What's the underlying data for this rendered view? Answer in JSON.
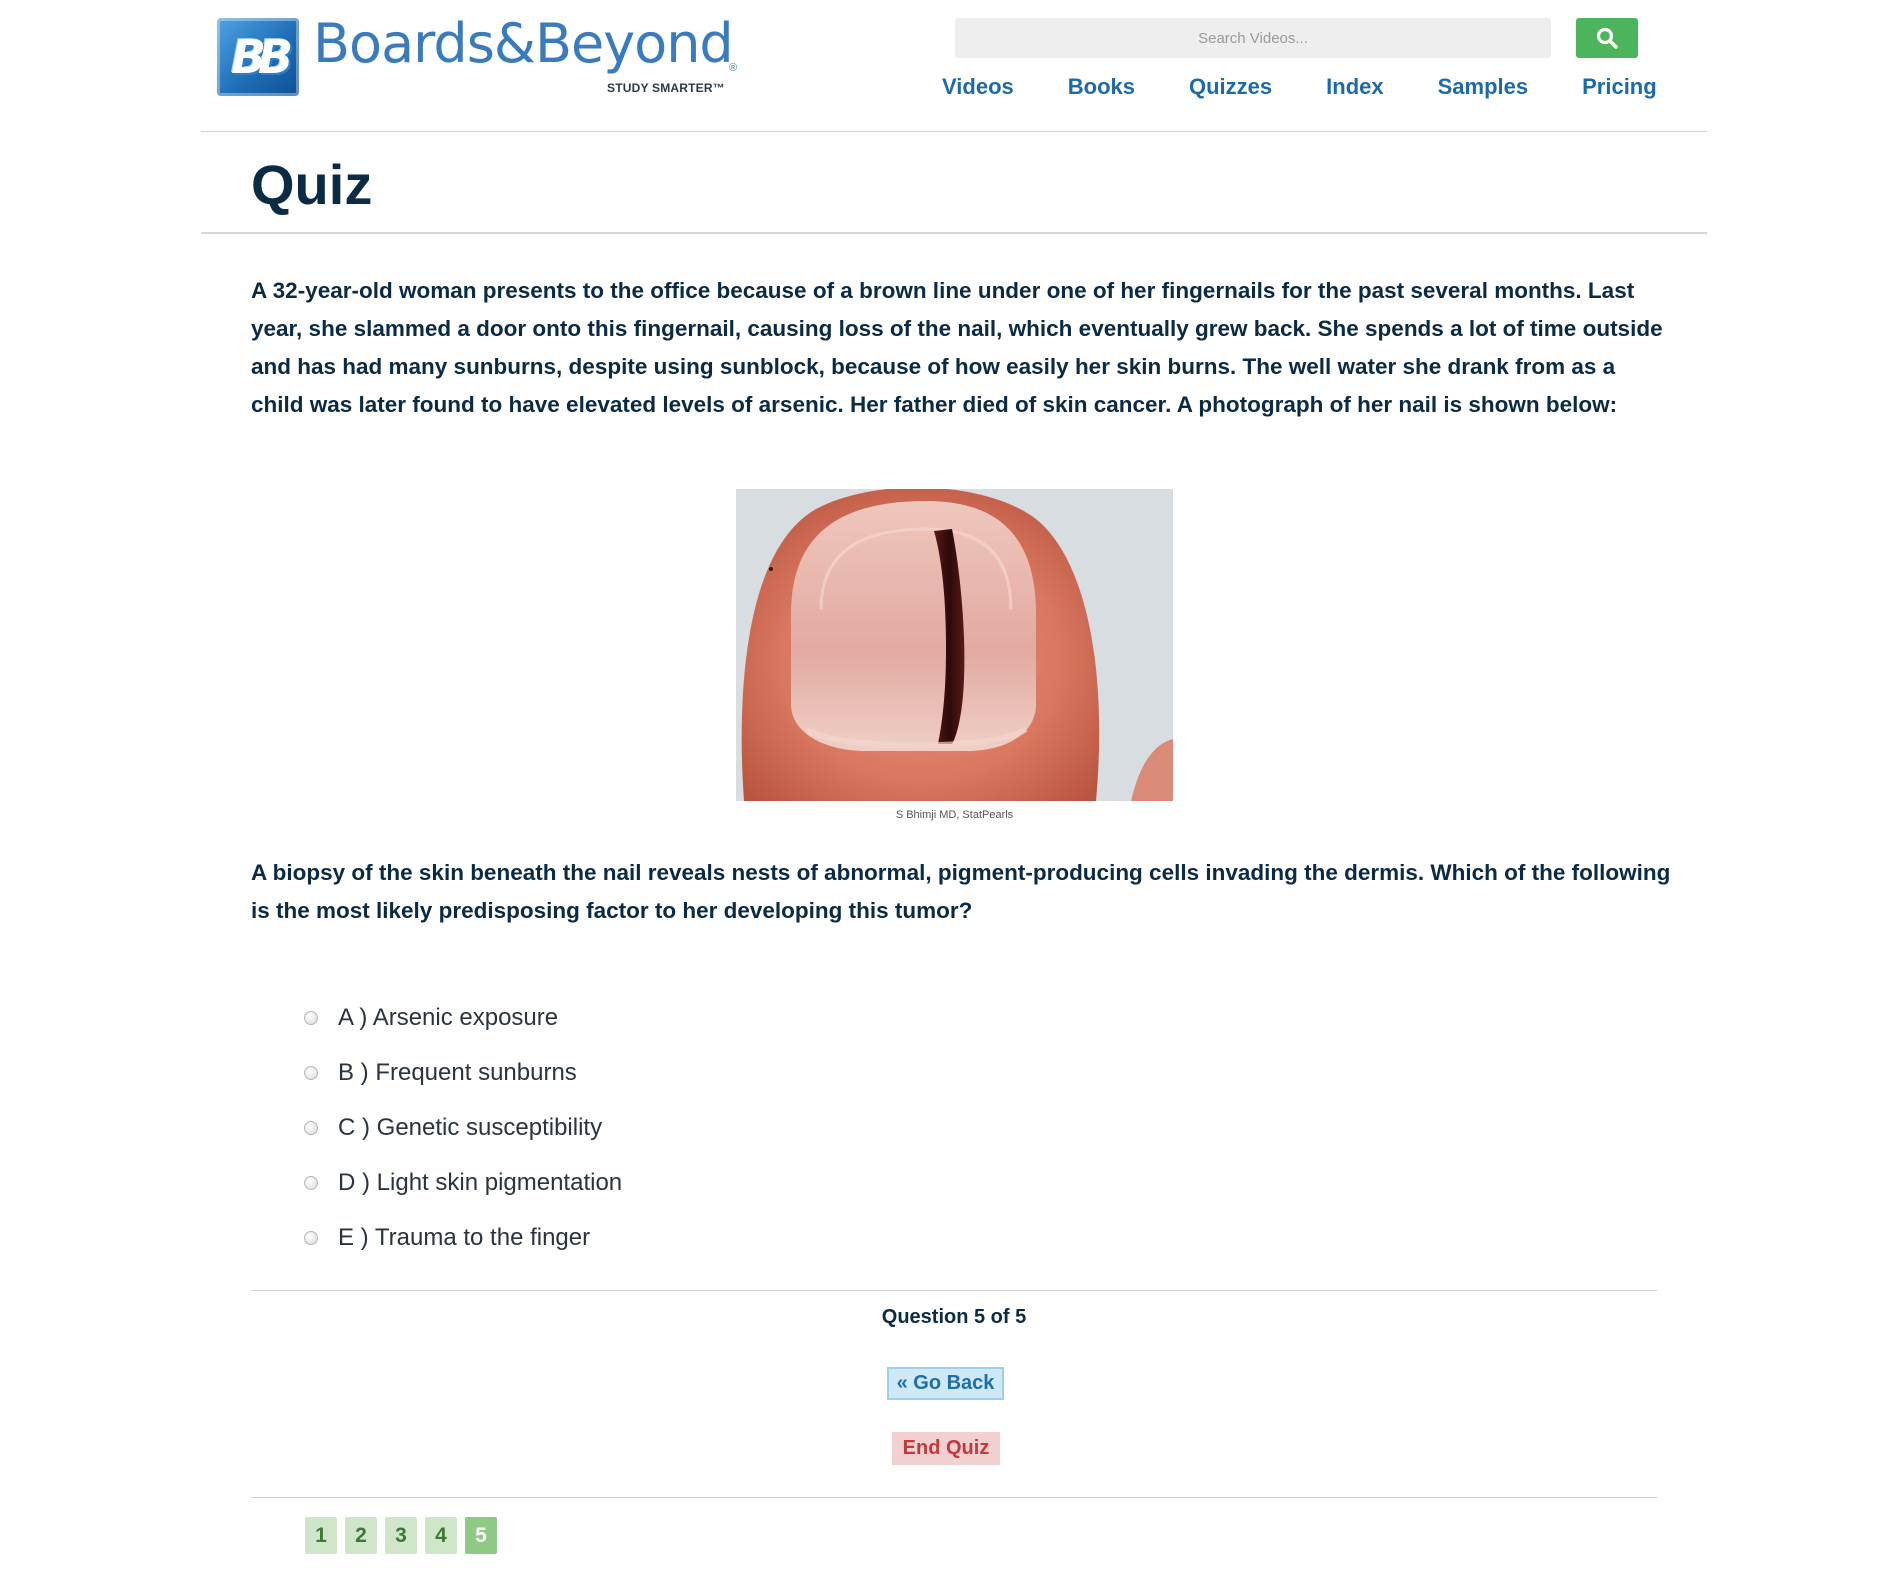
{
  "brand": {
    "badge": "BB",
    "name": "Boards&Beyond",
    "registered": "®",
    "tagline": "STUDY SMARTER™"
  },
  "search": {
    "placeholder": "Search Videos...",
    "button_icon": "search-icon",
    "button_color": "#4cb45c"
  },
  "nav": {
    "items": [
      {
        "label": "Videos"
      },
      {
        "label": "Books"
      },
      {
        "label": "Quizzes"
      },
      {
        "label": "Index"
      },
      {
        "label": "Samples"
      },
      {
        "label": "Pricing"
      }
    ]
  },
  "page": {
    "title": "Quiz"
  },
  "quiz": {
    "stem": "A 32-year-old woman presents to the office because of a brown line under one of her fingernails for the past several months. Last year, she slammed a door onto this fingernail, causing loss of the nail, which eventually grew back. She spends a lot of time outside and has had many sunburns, despite using sunblock, because of how easily her skin burns. The well water she drank from as a child was later found to have elevated levels of arsenic. Her father died of skin cancer. A photograph of her nail is shown below:",
    "image_credit": "S Bhimji MD, StatPearls",
    "question": "A biopsy of the skin beneath the nail reveals nests of abnormal, pigment-producing cells invading the dermis. Which of the following is the most likely predisposing factor to her developing this tumor?",
    "options": [
      {
        "label": "A ) Arsenic exposure"
      },
      {
        "label": "B ) Frequent sunburns"
      },
      {
        "label": "C ) Genetic susceptibility"
      },
      {
        "label": "D ) Light skin pigmentation"
      },
      {
        "label": "E ) Trauma to the finger"
      }
    ],
    "progress": "Question 5 of 5",
    "go_back_label": "« Go Back",
    "end_quiz_label": "End Quiz",
    "pages": [
      "1",
      "2",
      "3",
      "4",
      "5"
    ],
    "current_page": "5"
  },
  "colors": {
    "nav_link": "#1d6aa8",
    "heading": "#0b2a44",
    "go_back_bg": "#cfe8f5",
    "end_quiz_bg": "#f2d0d1",
    "page_btn_bg": "#cfe6c9",
    "page_btn_active_bg": "#8fca84"
  }
}
